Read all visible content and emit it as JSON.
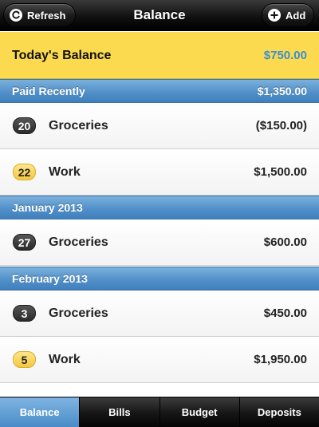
{
  "header": {
    "title": "Balance",
    "refresh_label": "Refresh",
    "add_label": "Add"
  },
  "today": {
    "label": "Today's Balance",
    "value": "$750.00"
  },
  "sections": [
    {
      "label": "Paid Recently",
      "amount": "$1,350.00",
      "rows": [
        {
          "day": "20",
          "name": "Groceries",
          "value": "($150.00)",
          "badge_style": "dark"
        },
        {
          "day": "22",
          "name": "Work",
          "value": "$1,500.00",
          "badge_style": "yellow"
        }
      ]
    },
    {
      "label": "January 2013",
      "amount": "",
      "rows": [
        {
          "day": "27",
          "name": "Groceries",
          "value": "$600.00",
          "badge_style": "dark"
        }
      ]
    },
    {
      "label": "February 2013",
      "amount": "",
      "rows": [
        {
          "day": "3",
          "name": "Groceries",
          "value": "$450.00",
          "badge_style": "dark"
        },
        {
          "day": "5",
          "name": "Work",
          "value": "$1,950.00",
          "badge_style": "yellow"
        }
      ]
    }
  ],
  "tabs": [
    {
      "label": "Balance",
      "active": true
    },
    {
      "label": "Bills",
      "active": false
    },
    {
      "label": "Budget",
      "active": false
    },
    {
      "label": "Deposits",
      "active": false
    }
  ],
  "colors": {
    "accent_blue": "#4f8ec8",
    "balance_value": "#3e8ed0",
    "today_bg": "#fbda4f"
  },
  "icons": {
    "refresh": "refresh-icon",
    "add": "plus-icon"
  }
}
